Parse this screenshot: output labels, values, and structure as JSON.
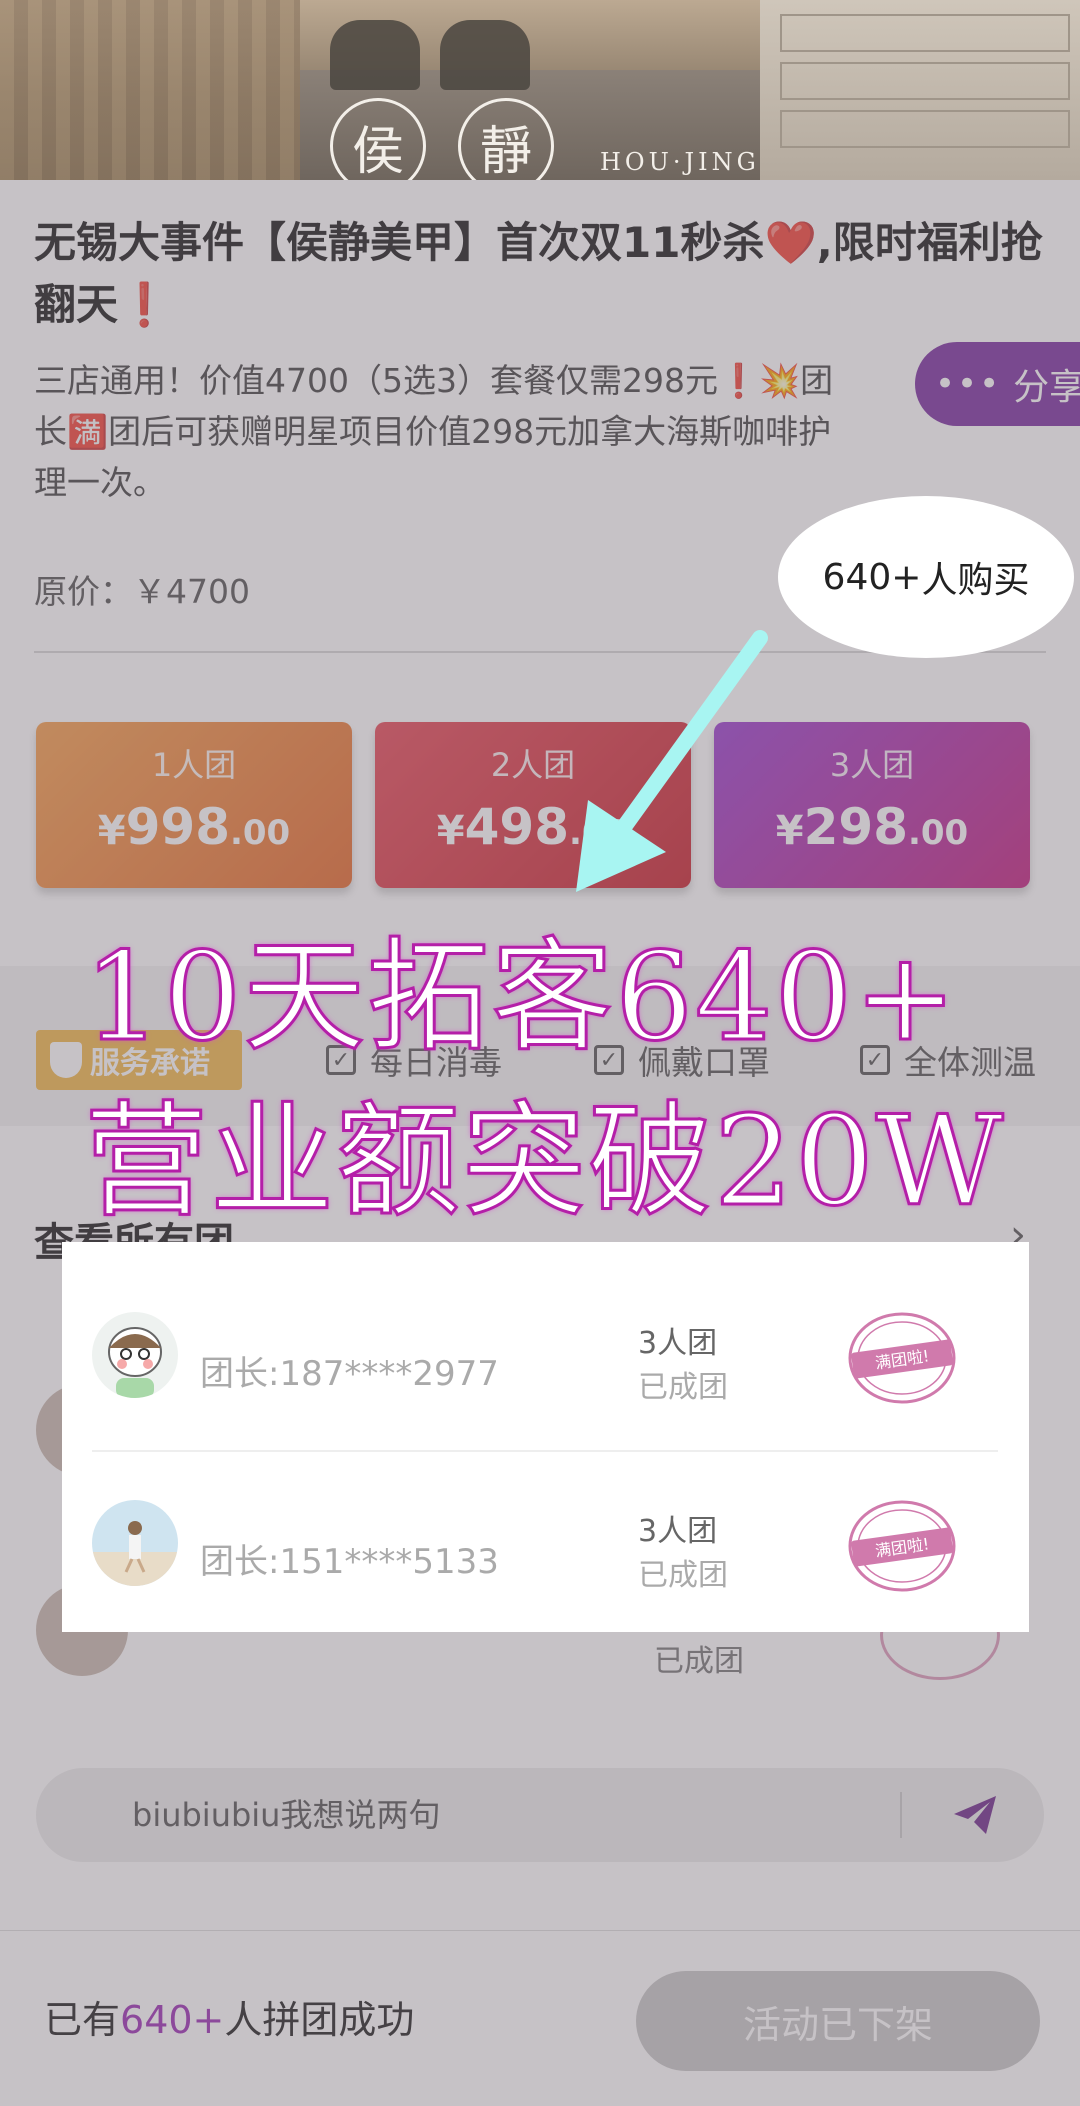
{
  "banner": {
    "logo_char_1": "侯",
    "logo_char_2": "靜",
    "logo_text": "HOU·JING"
  },
  "title": "无锡大事件【侯静美甲】首次双11秒杀❤️,限时福利抢翻天❗",
  "description": "三店通用！价值4700（5选3）套餐仅需298元❗💥团长🈵团后可获赠明星项目价值298元加拿大海斯咖啡护理一次。",
  "share": {
    "dots": "•••",
    "label": "分享"
  },
  "original_price": "原价：￥4700",
  "buyers": {
    "count": "640+",
    "label": "人购买"
  },
  "group_cards": [
    {
      "label": "1人团",
      "currency": "¥",
      "integer": "998",
      "decimal": ".00"
    },
    {
      "label": "2人团",
      "currency": "¥",
      "integer": "498",
      "decimal": ".00"
    },
    {
      "label": "3人团",
      "currency": "¥",
      "integer": "298",
      "decimal": ".00"
    }
  ],
  "service": {
    "badge": "服务承诺",
    "items": [
      "每日消毒",
      "佩戴口罩",
      "全体测温"
    ]
  },
  "promo": {
    "line1": "10天拓客640+",
    "line2": "营业额突破20W"
  },
  "groups_section": {
    "heading": "查看所有团",
    "chevron": "›",
    "background_status": "已成团",
    "rows": [
      {
        "leader": "团长:187****2977",
        "size": "3人团",
        "status": "已成团",
        "stamp": "满团啦!"
      },
      {
        "leader": "团长:151****5133",
        "size": "3人团",
        "status": "已成团",
        "stamp": "满团啦!"
      }
    ]
  },
  "comment": {
    "placeholder": "biubiubiu我想说两句"
  },
  "bottom": {
    "prefix": "已有",
    "count": "640+",
    "suffix": "人拼团成功",
    "button": "活动已下架"
  },
  "colors": {
    "accent_purple": "#9c2fb5",
    "share_bg": "#7b2fa0",
    "card1": "#e66a2c",
    "card2": "#c9242f",
    "card3": "#9b3fd0",
    "promo_stroke": "#b41fa8",
    "arrow": "#a8f5f2"
  }
}
